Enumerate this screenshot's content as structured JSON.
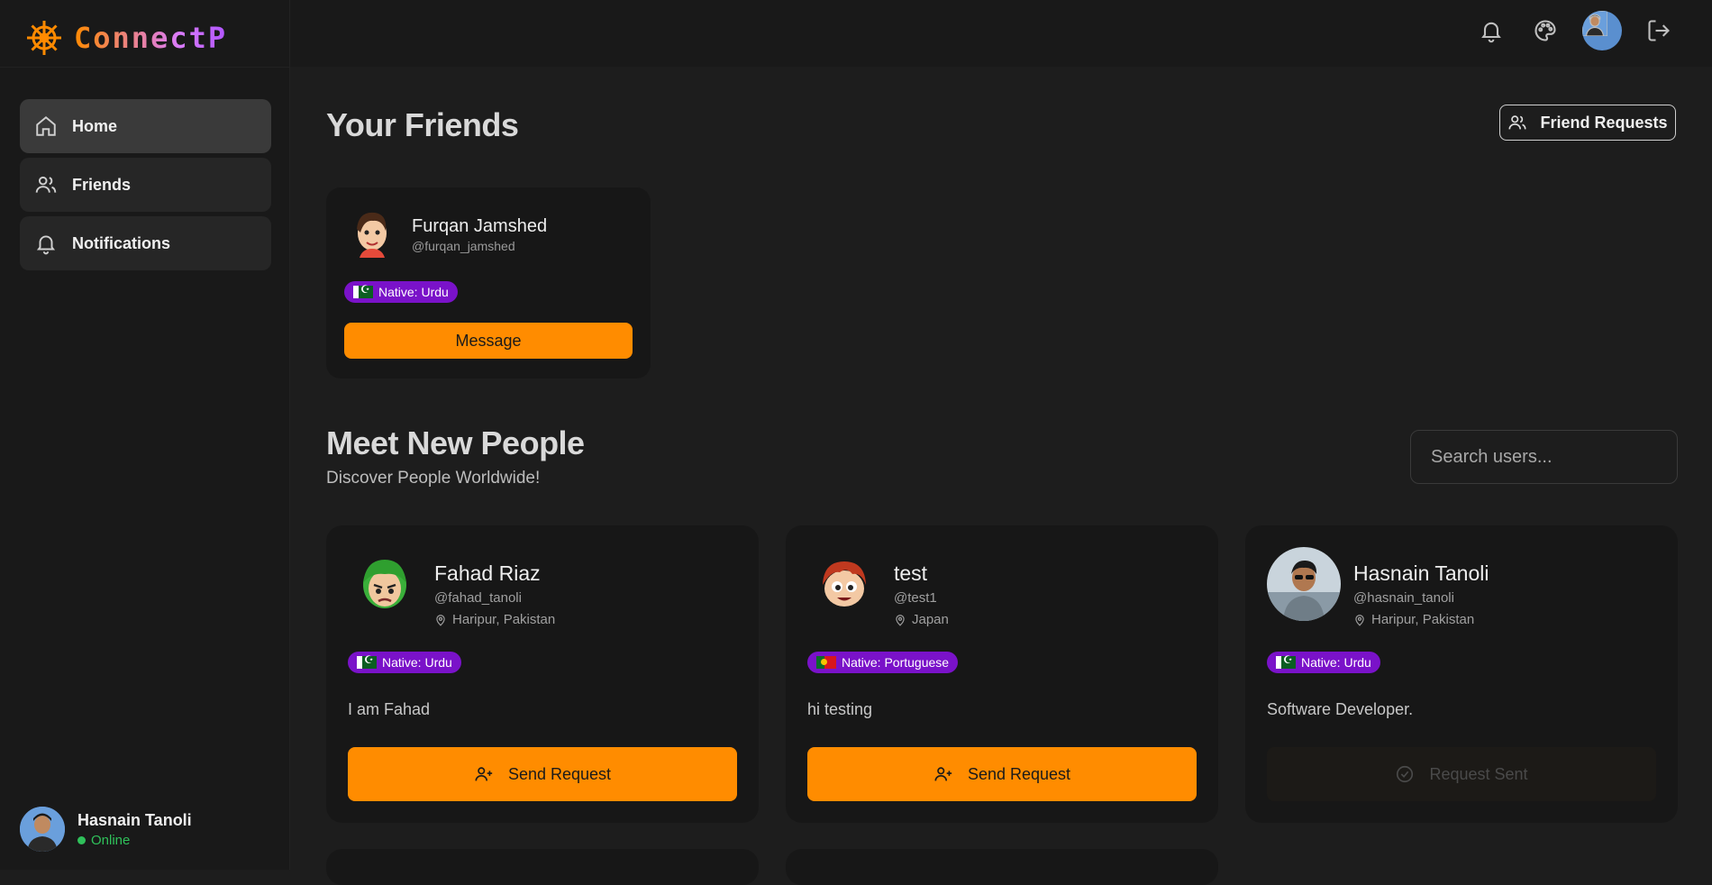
{
  "app": {
    "name": "ConnectP"
  },
  "sidebar": {
    "items": [
      {
        "label": "Home",
        "icon": "home-icon",
        "active": true
      },
      {
        "label": "Friends",
        "icon": "users-icon",
        "active": false
      },
      {
        "label": "Notifications",
        "icon": "bell-icon",
        "active": false
      }
    ],
    "current_user": {
      "name": "Hasnain Tanoli",
      "status": "Online"
    }
  },
  "topbar": {
    "icons": [
      "bell-icon",
      "palette-icon",
      "avatar",
      "logout-icon"
    ]
  },
  "friends_section": {
    "title": "Your Friends",
    "requests_button": "Friend Requests",
    "friends": [
      {
        "name": "Furqan Jamshed",
        "handle": "@furqan_jamshed",
        "language": "Native: Urdu",
        "action": "Message"
      }
    ]
  },
  "meet_section": {
    "title": "Meet New People",
    "subtitle": "Discover People Worldwide!",
    "search_placeholder": "Search users...",
    "users": [
      {
        "name": "Fahad Riaz",
        "handle": "@fahad_tanoli",
        "location": "Haripur, Pakistan",
        "language": "Native: Urdu",
        "bio": "I am Fahad",
        "action": "Send Request"
      },
      {
        "name": "test",
        "handle": "@test1",
        "location": "Japan",
        "language": "Native: Portuguese",
        "bio": "hi testing",
        "action": "Send Request"
      },
      {
        "name": "Hasnain Tanoli",
        "handle": "@hasnain_tanoli",
        "location": "Haripur, Pakistan",
        "language": "Native: Urdu",
        "bio": "Software Developer.",
        "action": "Request Sent"
      }
    ]
  },
  "colors": {
    "accent": "#ff8c00",
    "badge": "#7a12c9",
    "online": "#2fc05a",
    "background": "#1d1d1d"
  }
}
